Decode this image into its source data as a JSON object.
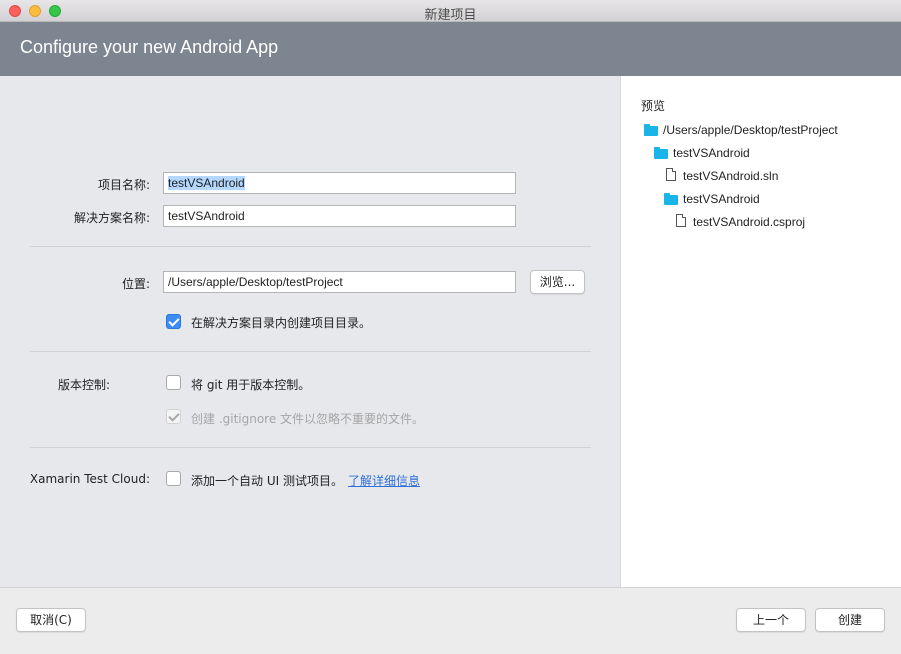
{
  "window": {
    "title": "新建项目"
  },
  "header": {
    "title": "Configure your new Android App"
  },
  "form": {
    "project_name_label": "项目名称:",
    "project_name_value": "testVSAndroid",
    "solution_name_label": "解决方案名称:",
    "solution_name_value": "testVSAndroid",
    "location_label": "位置:",
    "location_value": "/Users/apple/Desktop/testProject",
    "browse_label": "浏览...",
    "create_dir_label": "在解决方案目录内创建项目目录。",
    "create_dir_checked": true,
    "vcs_label": "版本控制:",
    "use_git_label": "将 git 用于版本控制。",
    "use_git_checked": false,
    "gitignore_label": "创建 .gitignore 文件以忽略不重要的文件。",
    "gitignore_checked": true,
    "gitignore_disabled": true,
    "test_cloud_label": "Xamarin Test Cloud:",
    "add_ui_test_label": "添加一个自动 UI 测试项目。",
    "add_ui_test_checked": false,
    "learn_more_label": "了解详细信息"
  },
  "preview": {
    "title": "预览",
    "tree": [
      {
        "type": "folder",
        "label": "/Users/apple/Desktop/testProject",
        "depth": 0
      },
      {
        "type": "folder",
        "label": "testVSAndroid",
        "depth": 1
      },
      {
        "type": "file",
        "label": "testVSAndroid.sln",
        "depth": 2
      },
      {
        "type": "folder",
        "label": "testVSAndroid",
        "depth": 2
      },
      {
        "type": "file",
        "label": "testVSAndroid.csproj",
        "depth": 3
      }
    ]
  },
  "footer": {
    "cancel_label": "取消(C)",
    "previous_label": "上一个",
    "create_label": "创建"
  },
  "colors": {
    "header_bg": "#7d8590",
    "accent": "#3b8cf5",
    "folder": "#19b5e8",
    "link": "#2f6fd6"
  }
}
